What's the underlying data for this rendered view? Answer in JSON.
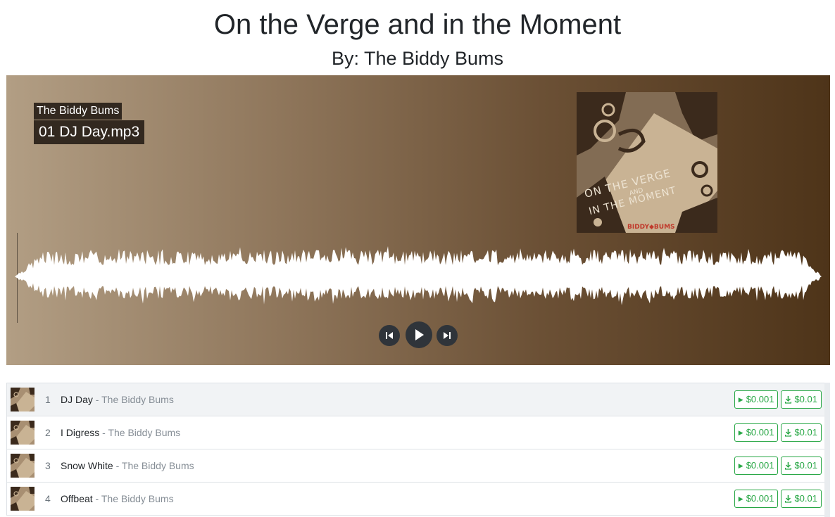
{
  "page": {
    "title": "On the Verge and in the Moment",
    "subtitle": "By: The Biddy Bums"
  },
  "player": {
    "artist": "The Biddy Bums",
    "now_playing": "01 DJ Day.mp3",
    "colors": {
      "gradient_start": "#b29e84",
      "gradient_end": "#4e3419",
      "waveform": "#ffffff",
      "control_bg": "#2f343a"
    },
    "cover_art": {
      "line1": "ON THE VERGE",
      "line2": "AND",
      "line3": "IN THE MOMENT",
      "logo": "BIDDY◆BUMS"
    },
    "controls": {
      "previous_icon": "skip-previous-icon",
      "play_icon": "play-icon",
      "next_icon": "skip-next-icon"
    }
  },
  "tracks": [
    {
      "number": "1",
      "title": "DJ Day",
      "separator": " - ",
      "artist": "The Biddy Bums",
      "stream_price": "$0.001",
      "download_price": "$0.01",
      "active": true
    },
    {
      "number": "2",
      "title": "I Digress",
      "separator": " - ",
      "artist": "The Biddy Bums",
      "stream_price": "$0.001",
      "download_price": "$0.01",
      "active": false
    },
    {
      "number": "3",
      "title": "Snow White",
      "separator": " - ",
      "artist": "The Biddy Bums",
      "stream_price": "$0.001",
      "download_price": "$0.01",
      "active": false
    },
    {
      "number": "4",
      "title": "Offbeat",
      "separator": " - ",
      "artist": "The Biddy Bums",
      "stream_price": "$0.001",
      "download_price": "$0.01",
      "active": false
    }
  ],
  "buttons": {
    "stream_icon": "play-icon",
    "download_icon": "download-icon",
    "accent": "#28a745"
  }
}
